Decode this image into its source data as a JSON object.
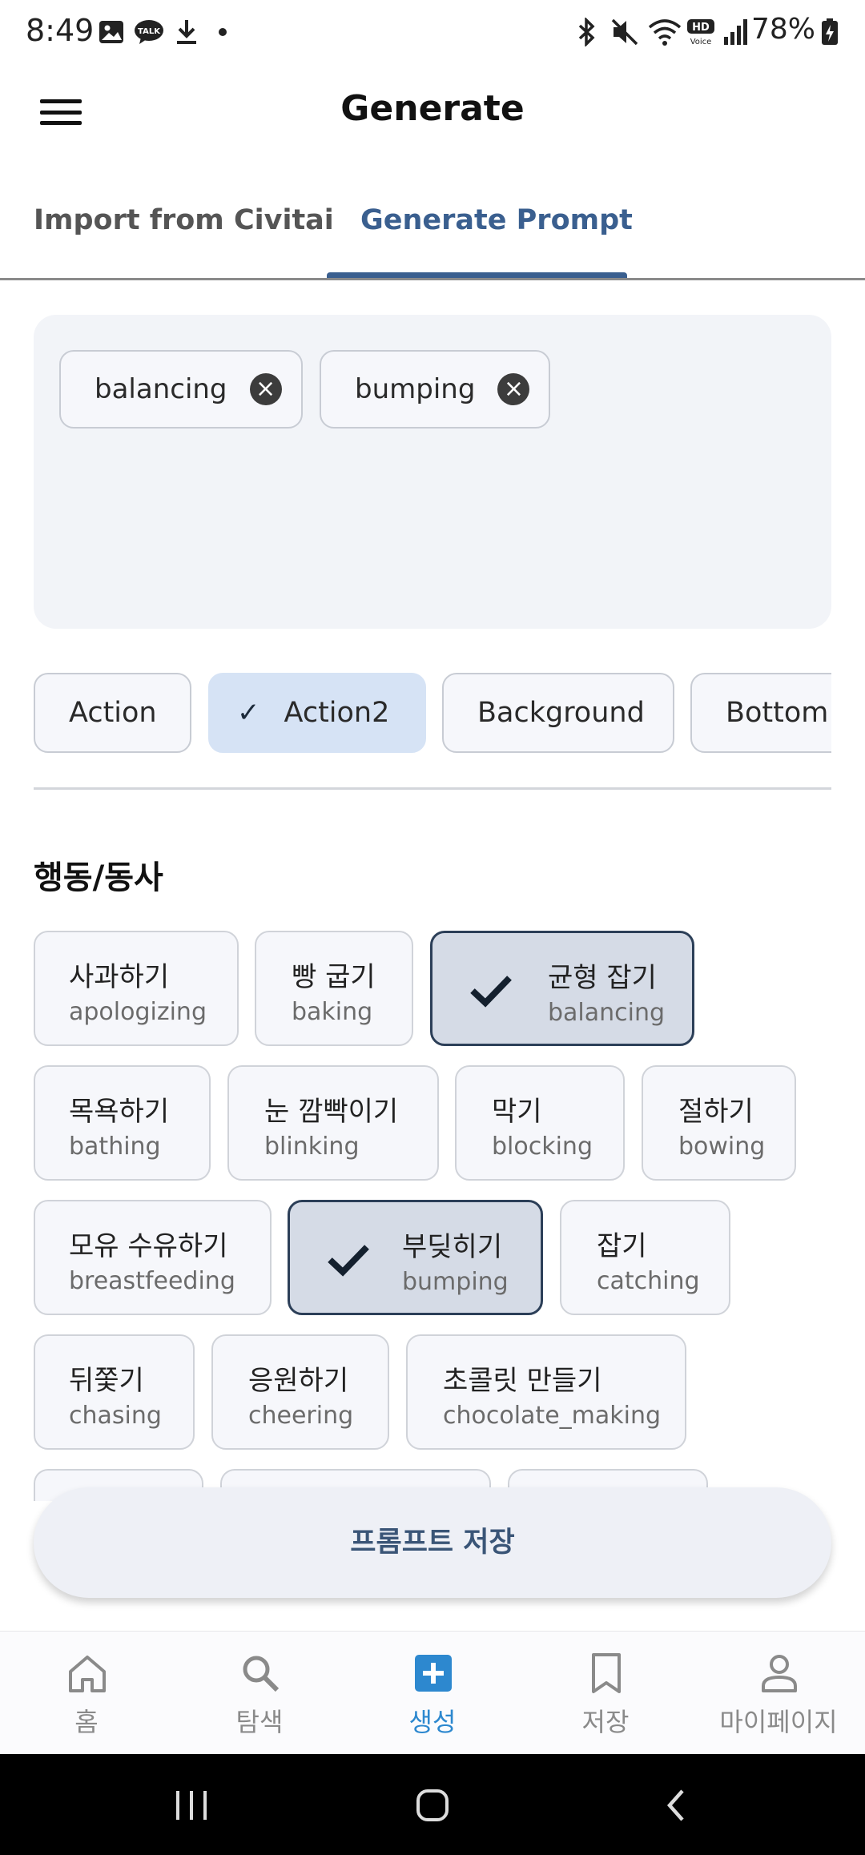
{
  "status_bar": {
    "time": "8:49",
    "battery": "78%",
    "icons": [
      "gallery-icon",
      "kakaotalk-icon",
      "download-icon",
      "dot-icon",
      "bluetooth-icon",
      "mute-icon",
      "wifi-icon",
      "hd-voice-icon",
      "signal-icon",
      "battery-icon"
    ]
  },
  "app_bar": {
    "title": "Generate",
    "menu_icon": "hamburger-menu-icon"
  },
  "tabs": [
    {
      "label": "Import from Civitai"
    },
    {
      "label": "Generate Prompt"
    }
  ],
  "selected_tags": [
    {
      "label": "balancing"
    },
    {
      "label": "bumping"
    }
  ],
  "categories": [
    {
      "label": "Action"
    },
    {
      "label": "Action2",
      "selected": true
    },
    {
      "label": "Background"
    },
    {
      "label": "Bottom"
    }
  ],
  "section": {
    "title": "행동/동사"
  },
  "actions": [
    {
      "ko": "사과하기",
      "en": "apologizing"
    },
    {
      "ko": "빵 굽기",
      "en": "baking"
    },
    {
      "ko": "균형 잡기",
      "en": "balancing",
      "selected": true
    },
    {
      "ko": "목욕하기",
      "en": "bathing"
    },
    {
      "ko": "눈 깜빡이기",
      "en": "blinking"
    },
    {
      "ko": "막기",
      "en": "blocking"
    },
    {
      "ko": "절하기",
      "en": "bowing"
    },
    {
      "ko": "모유 수유하기",
      "en": "breastfeeding"
    },
    {
      "ko": "부딪히기",
      "en": "bumping",
      "selected": true
    },
    {
      "ko": "잡기",
      "en": "catching"
    },
    {
      "ko": "뒤쫓기",
      "en": "chasing"
    },
    {
      "ko": "응원하기",
      "en": "cheering"
    },
    {
      "ko": "초콜릿 만들기",
      "en": "chocolate_making"
    }
  ],
  "save_button": {
    "label": "프롬프트 저장"
  },
  "bottom_nav": [
    {
      "label": "홈",
      "icon": "home-icon"
    },
    {
      "label": "탐색",
      "icon": "search-icon"
    },
    {
      "label": "생성",
      "icon": "add-box-icon",
      "active": true
    },
    {
      "label": "저장",
      "icon": "bookmark-icon"
    },
    {
      "label": "마이페이지",
      "icon": "person-icon"
    }
  ],
  "colors": {
    "accent": "#3a5f8f",
    "nav_active": "#2d88cf",
    "chip_selected": "#d6e3f5"
  }
}
